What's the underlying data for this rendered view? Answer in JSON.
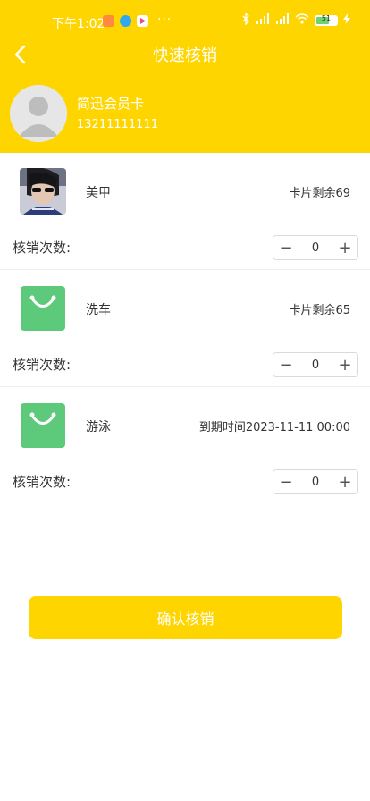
{
  "status": {
    "time": "下午1:02",
    "dots": "···",
    "signal1": "4G",
    "signal2": "4G",
    "battery": "51"
  },
  "header": {
    "title": "快速核销",
    "member_name": "简迅会员卡",
    "member_phone": "13211111111"
  },
  "items": [
    {
      "name": "美甲",
      "info": "卡片剩余69",
      "count_label": "核销次数:",
      "count": "0",
      "icon": "photo-thumbnail"
    },
    {
      "name": "洗车",
      "info": "卡片剩余65",
      "count_label": "核销次数:",
      "count": "0",
      "icon": "shopping-bag-icon"
    },
    {
      "name": "游泳",
      "info": "到期时间2023-11-11 00:00",
      "count_label": "核销次数:",
      "count": "0",
      "icon": "shopping-bag-icon"
    }
  ],
  "stepper": {
    "minus": "−",
    "plus": "+"
  },
  "confirm_label": "确认核销",
  "colors": {
    "accent": "#FFD500",
    "bag_green": "#5DC97A"
  }
}
